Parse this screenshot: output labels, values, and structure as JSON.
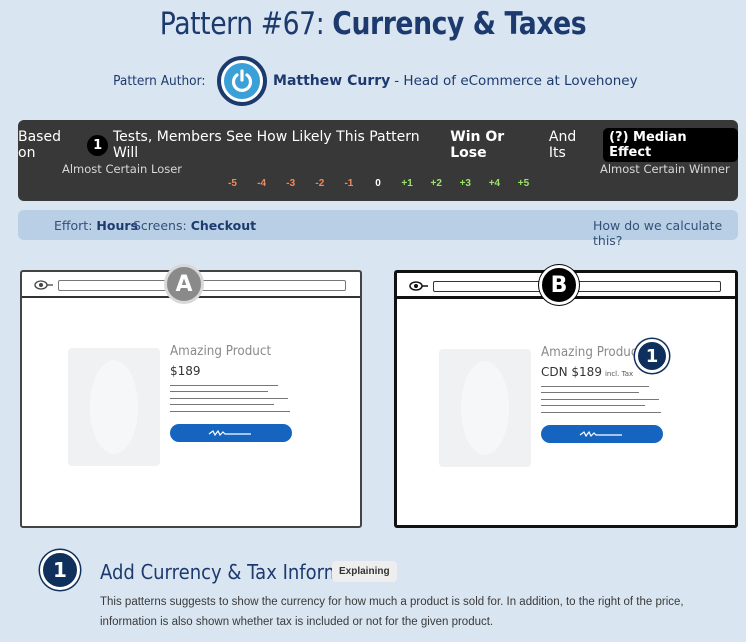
{
  "page": {
    "title_prefix": "Pattern #67: ",
    "title_main": "Currency & Taxes"
  },
  "author": {
    "label": "Pattern Author:",
    "name": "Matthew Curry",
    "role": " - Head of eCommerce at Lovehoney"
  },
  "likelihood": {
    "based_on": "Based on",
    "tests_count": "1",
    "sentence_mid": "Tests, Members See How Likely This Pattern Will",
    "win_or_lose": "Win Or Lose",
    "sentence_end": "And Its",
    "median_effect": "(?) Median Effect",
    "left_label": "Almost Certain Loser",
    "right_label": "Almost Certain Winner",
    "scale": [
      "-5",
      "-4",
      "-3",
      "-2",
      "-1",
      "0",
      "+1",
      "+2",
      "+3",
      "+4",
      "+5"
    ]
  },
  "meta": {
    "effort_label": "Effort:",
    "effort_value": "Hours",
    "screens_label": "Screens:",
    "screens_value": "Checkout",
    "calc_link": "How do we calculate this?"
  },
  "variant_a": {
    "badge": "A",
    "product_name": "Amazing Product",
    "price": "$189"
  },
  "variant_b": {
    "badge": "B",
    "product_name": "Amazing Product",
    "price": "CDN $189",
    "tax_note": "incl. Tax",
    "marker": "1"
  },
  "step": {
    "number": "1",
    "title": "Add Currency & Tax Information",
    "tag": "Explaining",
    "description": "This patterns suggests to show the currency for how much a product is sold for. In addition, to the right of the price, information is also shown whether tax is included or not for the given product."
  },
  "colors": {
    "navy": "#1d3a6e",
    "cta_blue": "#1565c0",
    "negative": "#f08a5d",
    "positive": "#9be36b"
  }
}
